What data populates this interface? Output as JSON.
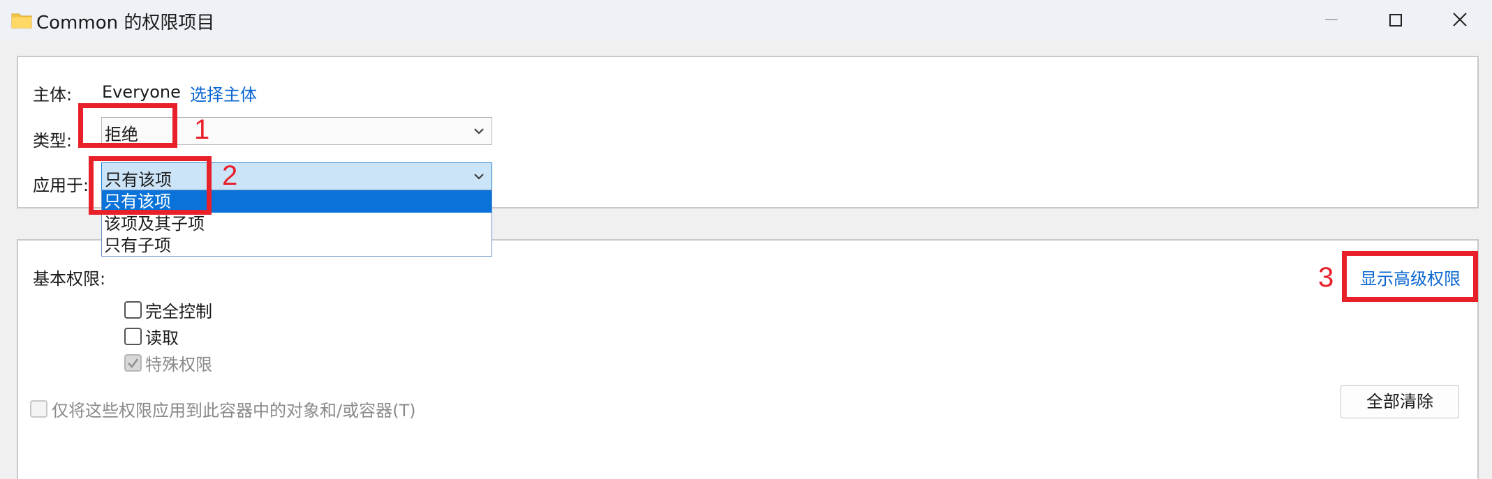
{
  "window": {
    "title": "Common 的权限项目",
    "icons": {
      "folder": "folder-icon",
      "minimize": "minimize-icon",
      "maximize": "maximize-icon",
      "close": "close-icon"
    }
  },
  "principal": {
    "label": "主体:",
    "value": "Everyone",
    "select_link": "选择主体"
  },
  "type": {
    "label": "类型:",
    "value": "拒绝"
  },
  "applies_to": {
    "label": "应用于:",
    "value": "只有该项",
    "options": [
      "只有该项",
      "该项及其子项",
      "只有子项"
    ],
    "selected_index": 0
  },
  "basic_permissions": {
    "label": "基本权限:",
    "show_advanced_link": "显示高级权限",
    "items": [
      {
        "label": "完全控制",
        "checked": false,
        "disabled": false
      },
      {
        "label": "读取",
        "checked": false,
        "disabled": false
      },
      {
        "label": "特殊权限",
        "checked": true,
        "disabled": true
      }
    ]
  },
  "apply_to_container": {
    "label": "仅将这些权限应用到此容器中的对象和/或容器(T)",
    "checked": false,
    "disabled": true
  },
  "clear_all_button": "全部清除",
  "annotations": {
    "color": "#e8202a",
    "numbers": [
      "1",
      "2",
      "3"
    ]
  },
  "colors": {
    "link": "#0a66d1",
    "selection": "#0a73d9",
    "combo_active": "#cce4f7"
  }
}
